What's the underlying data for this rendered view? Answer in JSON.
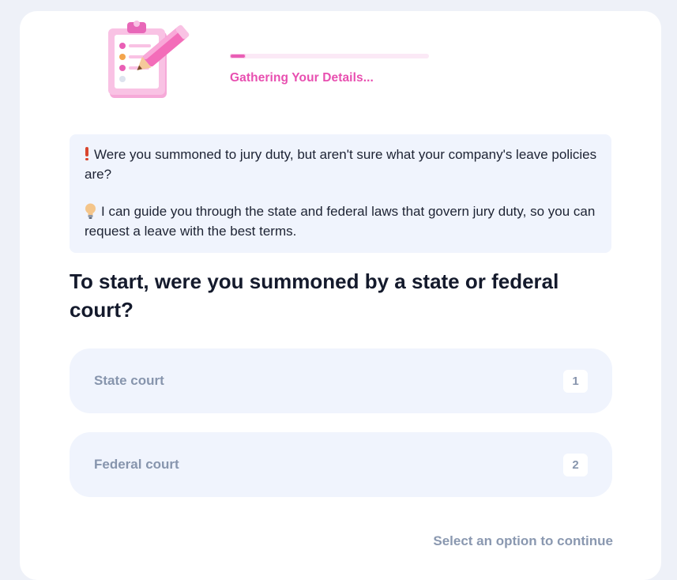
{
  "header": {
    "illustration": "clipboard-pencil-icon",
    "progress_fraction": 0.08,
    "progress_label": "Gathering Your Details..."
  },
  "intro": {
    "line1_icon": "exclamation-icon",
    "line1": "Were you summoned to jury duty, but aren't sure what your company's leave policies are?",
    "line2_icon": "lightbulb-icon",
    "line2": "I can guide you through the state and federal laws that govern jury duty, so you can request a leave with the best terms."
  },
  "question": {
    "text": "To start, were you summoned by a state or federal court?"
  },
  "options": [
    {
      "label": "State court",
      "key": "1"
    },
    {
      "label": "Federal court",
      "key": "2"
    }
  ],
  "footer": {
    "hint": "Select an option to continue"
  },
  "colors": {
    "accent_pink": "#e84fb0",
    "info_background": "#f0f4fd",
    "option_text": "#8795ad",
    "heading": "#141a2c"
  }
}
